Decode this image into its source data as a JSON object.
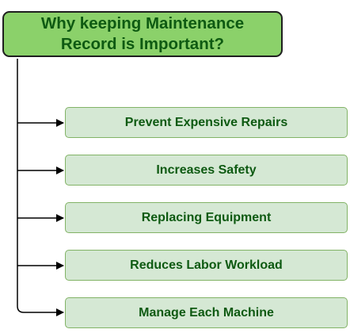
{
  "title": {
    "line1": "Why keeping Maintenance",
    "line2": "Record is Important?"
  },
  "items": [
    {
      "label": "Prevent Expensive Repairs"
    },
    {
      "label": "Increases Safety"
    },
    {
      "label": "Replacing Equipment"
    },
    {
      "label": "Reduces Labor Workload"
    },
    {
      "label": "Manage Each Machine"
    }
  ],
  "colors": {
    "title_fill": "#8bd16a",
    "title_text": "#0e5a12",
    "item_fill": "#d5e8d4",
    "item_border": "#82b366",
    "connector": "#000000"
  }
}
